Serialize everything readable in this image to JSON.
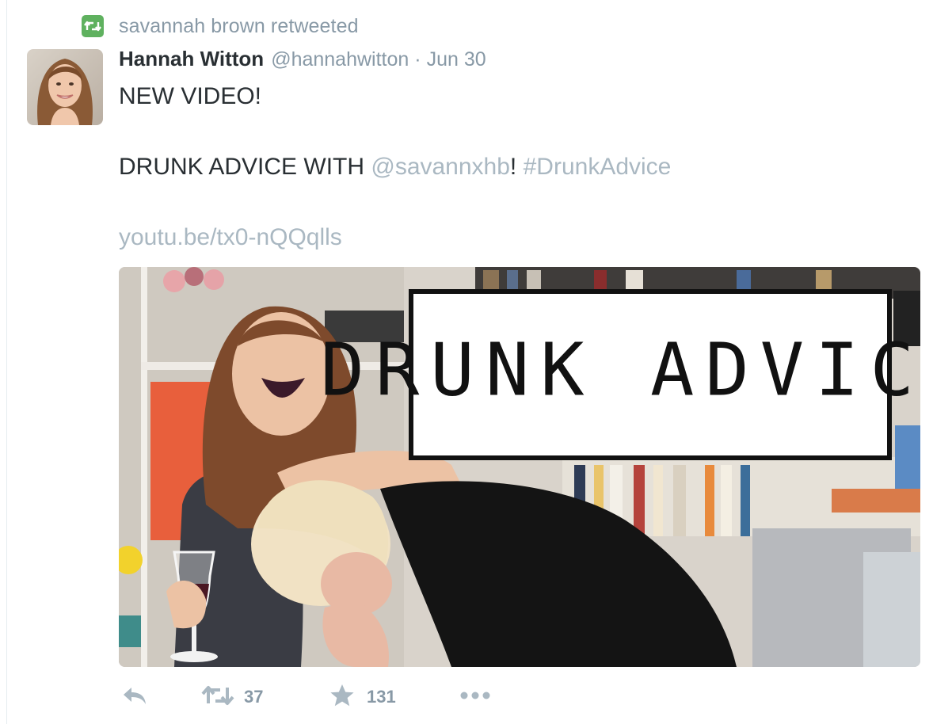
{
  "retweet_context": {
    "icon": "retweet-icon",
    "text": "savannah brown retweeted",
    "badge_color": "#5fb15f"
  },
  "tweet": {
    "fullname": "Hannah Witton",
    "handle": "@hannahwitton",
    "separator": "·",
    "time": "Jun 30",
    "lines": {
      "line1": "NEW VIDEO!",
      "line2_prefix": "DRUNK ADVICE WITH ",
      "line2_mention": "@savannxhb",
      "line2_bang": "!",
      "line2_space": " ",
      "line2_hashtag": "#DrunkAdvice",
      "link": "youtu.be/tx0-nQQqlls"
    },
    "media": {
      "title_card": "DRUNK ADVICE"
    }
  },
  "actions": {
    "reply_icon": "reply-icon",
    "retweet_icon": "retweet-icon",
    "retweet_count": "37",
    "favorite_icon": "star-icon",
    "favorite_count": "131",
    "more_icon": "more-icon"
  },
  "colors": {
    "text": "#292f33",
    "muted": "#8899a6",
    "link_muted": "#aab8c2",
    "icon": "#aab8c2"
  }
}
